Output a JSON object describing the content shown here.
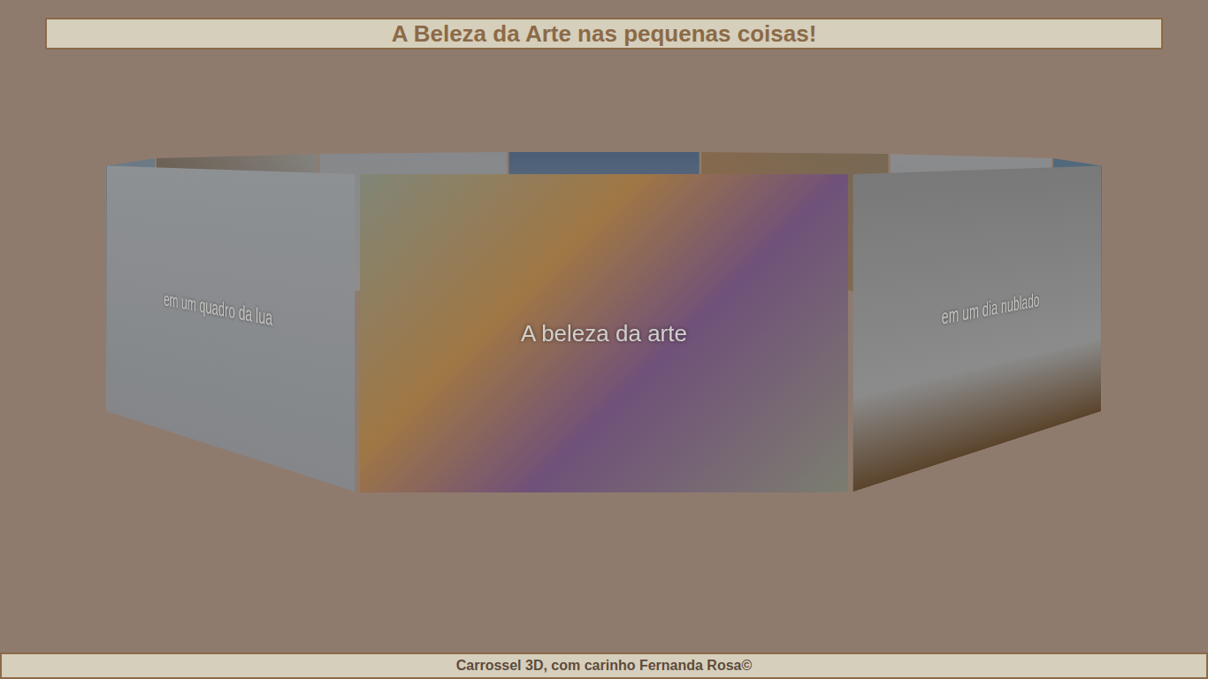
{
  "header": {
    "title": "A Beleza da Arte nas pequenas coisas!"
  },
  "carousel": {
    "cards": [
      {
        "caption": "A beleza da arte",
        "selected": true
      },
      {
        "caption": "em um dia nublado",
        "selected": false
      },
      {
        "caption": "",
        "selected": false
      },
      {
        "caption": "",
        "selected": false
      },
      {
        "caption": "",
        "selected": false
      },
      {
        "caption": "",
        "selected": false
      },
      {
        "caption": "",
        "selected": false
      },
      {
        "caption": "",
        "selected": false
      },
      {
        "caption": "",
        "selected": false
      },
      {
        "caption": "em um quadro da lua",
        "selected": false
      }
    ]
  },
  "footer": {
    "text": "Carrossel 3D, com carinho Fernanda Rosa©"
  }
}
